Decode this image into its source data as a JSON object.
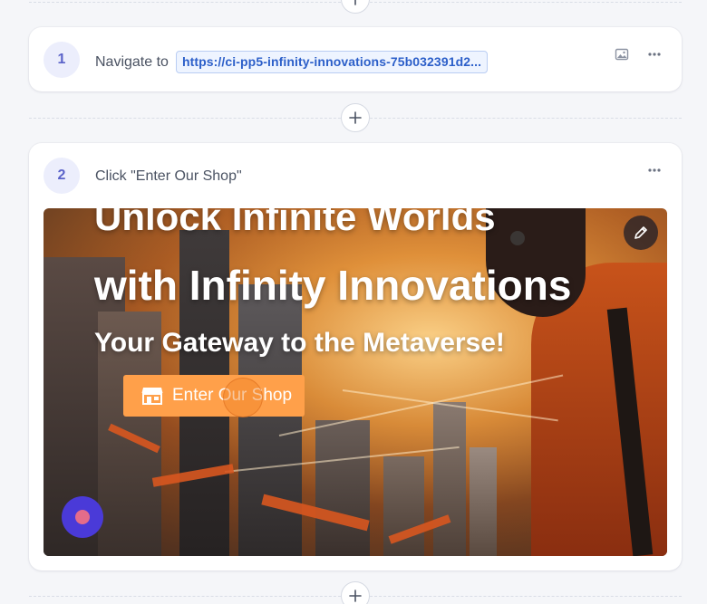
{
  "colors": {
    "accent": "#5b63c9",
    "url_chip_text": "#2c5fc9",
    "shop_button": "#ffa04a",
    "record_button": "#4a3ad8"
  },
  "steps": [
    {
      "number": "1",
      "action_label": "Navigate to",
      "url": "https://ci-pp5-infinity-innovations-75b032391d2...",
      "icons": [
        "image-icon",
        "more-horizontal-icon"
      ]
    },
    {
      "number": "2",
      "action_label": "Click \"Enter Our Shop\"",
      "icons": [
        "more-horizontal-icon"
      ],
      "screenshot": {
        "headline_1": "Unlock Infinite Worlds",
        "headline_2": "with Infinity Innovations",
        "tagline": "Your Gateway to the Metaverse!",
        "shop_button_label": "Enter Our Shop",
        "shop_button_icon": "storefront-icon"
      }
    }
  ]
}
